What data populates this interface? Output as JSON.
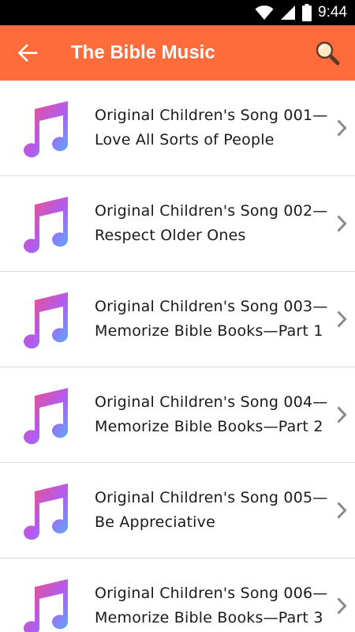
{
  "status_bar": {
    "time": "9:44",
    "icons": [
      "wifi-icon",
      "signal-icon",
      "battery-icon"
    ]
  },
  "app_bar": {
    "title": "The Bible Music",
    "back_icon": "arrow-left-icon",
    "search_icon": "search-icon",
    "background_color": "#ff6c3b"
  },
  "songs": [
    {
      "title": "Original Children's Song 001—Love All Sorts of People",
      "icon": "music-note-icon"
    },
    {
      "title": "Original Children's Song 002—Respect Older Ones",
      "icon": "music-note-icon"
    },
    {
      "title": "Original Children's Song 003—Memorize Bible Books—Part 1",
      "icon": "music-note-icon"
    },
    {
      "title": "Original Children's Song 004—Memorize Bible Books—Part 2",
      "icon": "music-note-icon"
    },
    {
      "title": "Original Children's Song 005—Be Appreciative",
      "icon": "music-note-icon"
    },
    {
      "title": "Original Children's Song 006—Memorize Bible Books—Part 3",
      "icon": "music-note-icon"
    }
  ]
}
